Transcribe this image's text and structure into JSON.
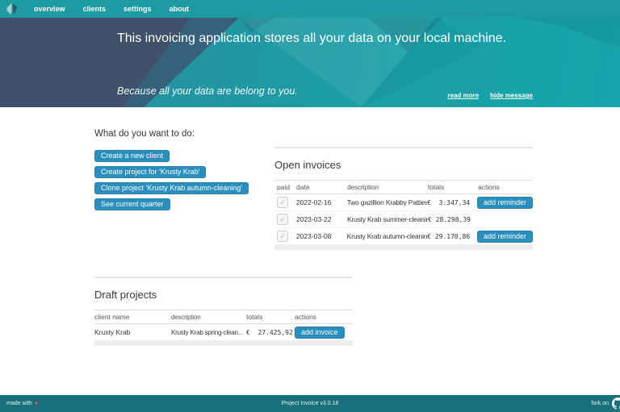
{
  "nav": {
    "items": [
      {
        "label": "overview"
      },
      {
        "label": "clients"
      },
      {
        "label": "settings"
      },
      {
        "label": "about"
      }
    ]
  },
  "hero": {
    "title": "This invoicing application stores all your data on your local machine.",
    "subtitle": "Because all your data are belong to you.",
    "links": [
      {
        "label": "read more"
      },
      {
        "label": "hide message"
      }
    ]
  },
  "actions_panel": {
    "heading": "What do you want to do:",
    "buttons": [
      {
        "label": "Create a new client"
      },
      {
        "label": "Create project for 'Krusty Krab'"
      },
      {
        "label": "Clone project 'Krusty Krab autumn-cleaning'"
      },
      {
        "label": "See current quarter"
      }
    ]
  },
  "open_invoices": {
    "title": "Open invoices",
    "columns": [
      "paid",
      "date",
      "description",
      "totals",
      "actions"
    ],
    "rows": [
      {
        "paid": true,
        "date": "2022-02-16",
        "description": "Two gazillion Krabby Patties",
        "total": "€  3.347,34",
        "action": "add reminder"
      },
      {
        "paid": true,
        "date": "2023-03-22",
        "description": "Krusty Krab summer-cleaning",
        "total": "€ 28.298,39",
        "action": ""
      },
      {
        "paid": true,
        "date": "2023-03-08",
        "description": "Krusty Krab autumn-cleaning",
        "total": "€ 29.170,86",
        "action": "add reminder"
      }
    ]
  },
  "draft_projects": {
    "title": "Draft projects",
    "columns": [
      "client name",
      "description",
      "totals",
      "actions"
    ],
    "rows": [
      {
        "client": "Krusty Krab",
        "description": "Krusty Krab spring-clean...",
        "total": "€  27.425,92",
        "action": "add invoice"
      }
    ]
  },
  "footer": {
    "made_with": "made with",
    "heart": "♥",
    "version": "Project Invoice v3.0.18",
    "fork_on": "fork on"
  },
  "ui": {
    "check_glyph": "✓"
  },
  "colors": {
    "navbar": "#1e9ba2",
    "hero_slate": "#3f5269",
    "hero_teal": "#16a5ac",
    "accent_button": "#2b8fbe",
    "footer": "#17707a"
  }
}
